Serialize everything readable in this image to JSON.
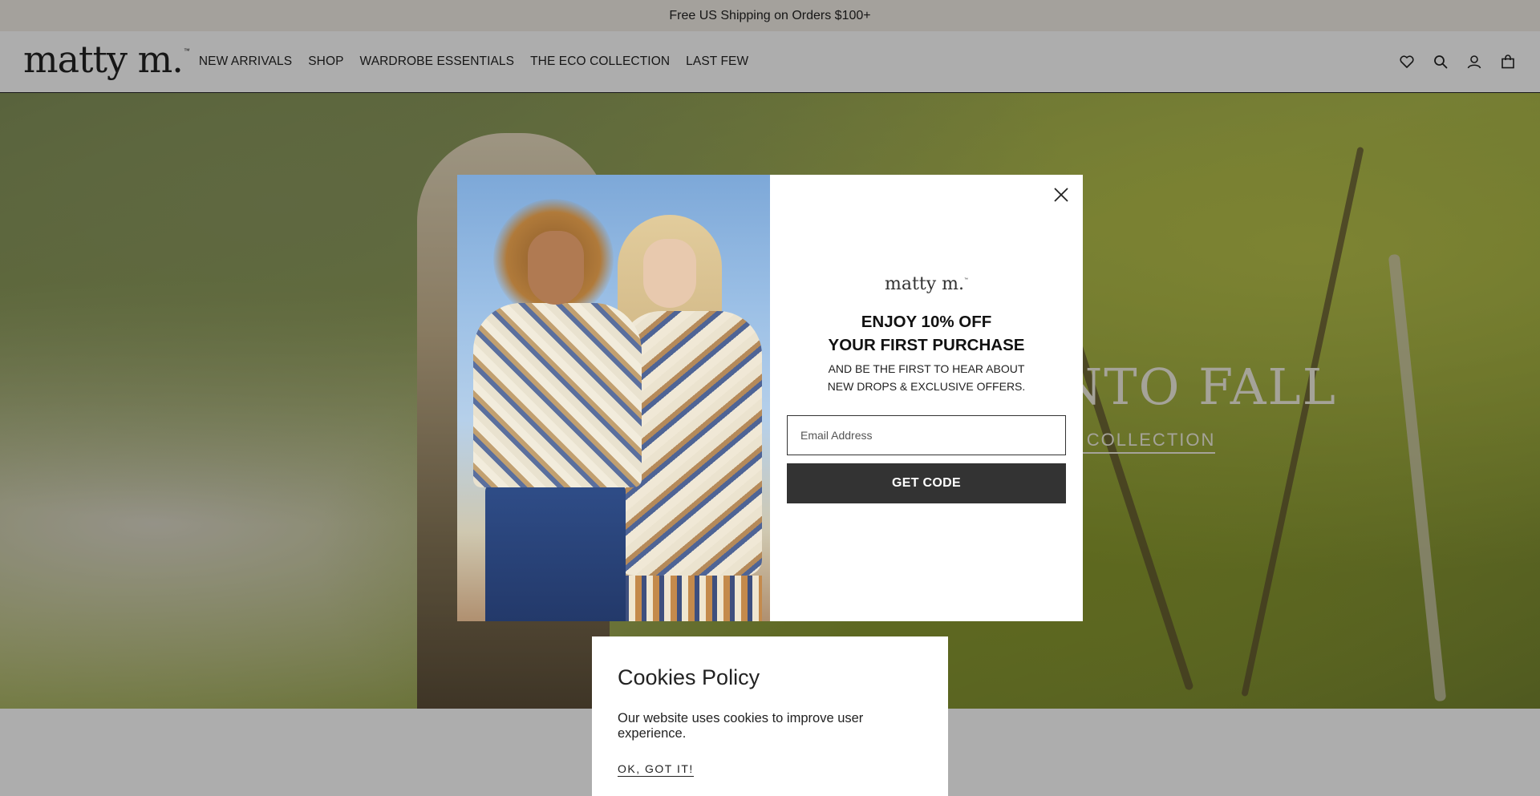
{
  "announcement": {
    "text": "Free US Shipping on Orders $100+"
  },
  "header": {
    "logo": "matty m.",
    "logo_mark": "™",
    "nav": [
      "NEW ARRIVALS",
      "SHOP",
      "WARDROBE ESSENTIALS",
      "THE ECO COLLECTION",
      "LAST FEW"
    ],
    "icons": [
      "heart-icon",
      "search-icon",
      "account-icon",
      "bag-icon"
    ]
  },
  "hero": {
    "title_fragment": "NTO FALL",
    "link_fragment": "E COLLECTION"
  },
  "popup": {
    "logo": "matty m.",
    "logo_mark": "™",
    "headline_line1": "ENJOY 10% OFF",
    "headline_line2": "YOUR FIRST PURCHASE",
    "sub_line1": "AND BE THE FIRST TO HEAR ABOUT",
    "sub_line2": "NEW DROPS & EXCLUSIVE OFFERS.",
    "email_placeholder": "Email Address",
    "button": "GET CODE",
    "close_icon": "close-icon"
  },
  "cookies": {
    "title": "Cookies Policy",
    "text": "Our website uses cookies to improve user experience.",
    "ok": "OK, GOT IT!"
  },
  "colors": {
    "announcement_bg": "#f2eee6",
    "button_bg": "#333333",
    "overlay": "rgba(0,0,0,0.32)"
  }
}
